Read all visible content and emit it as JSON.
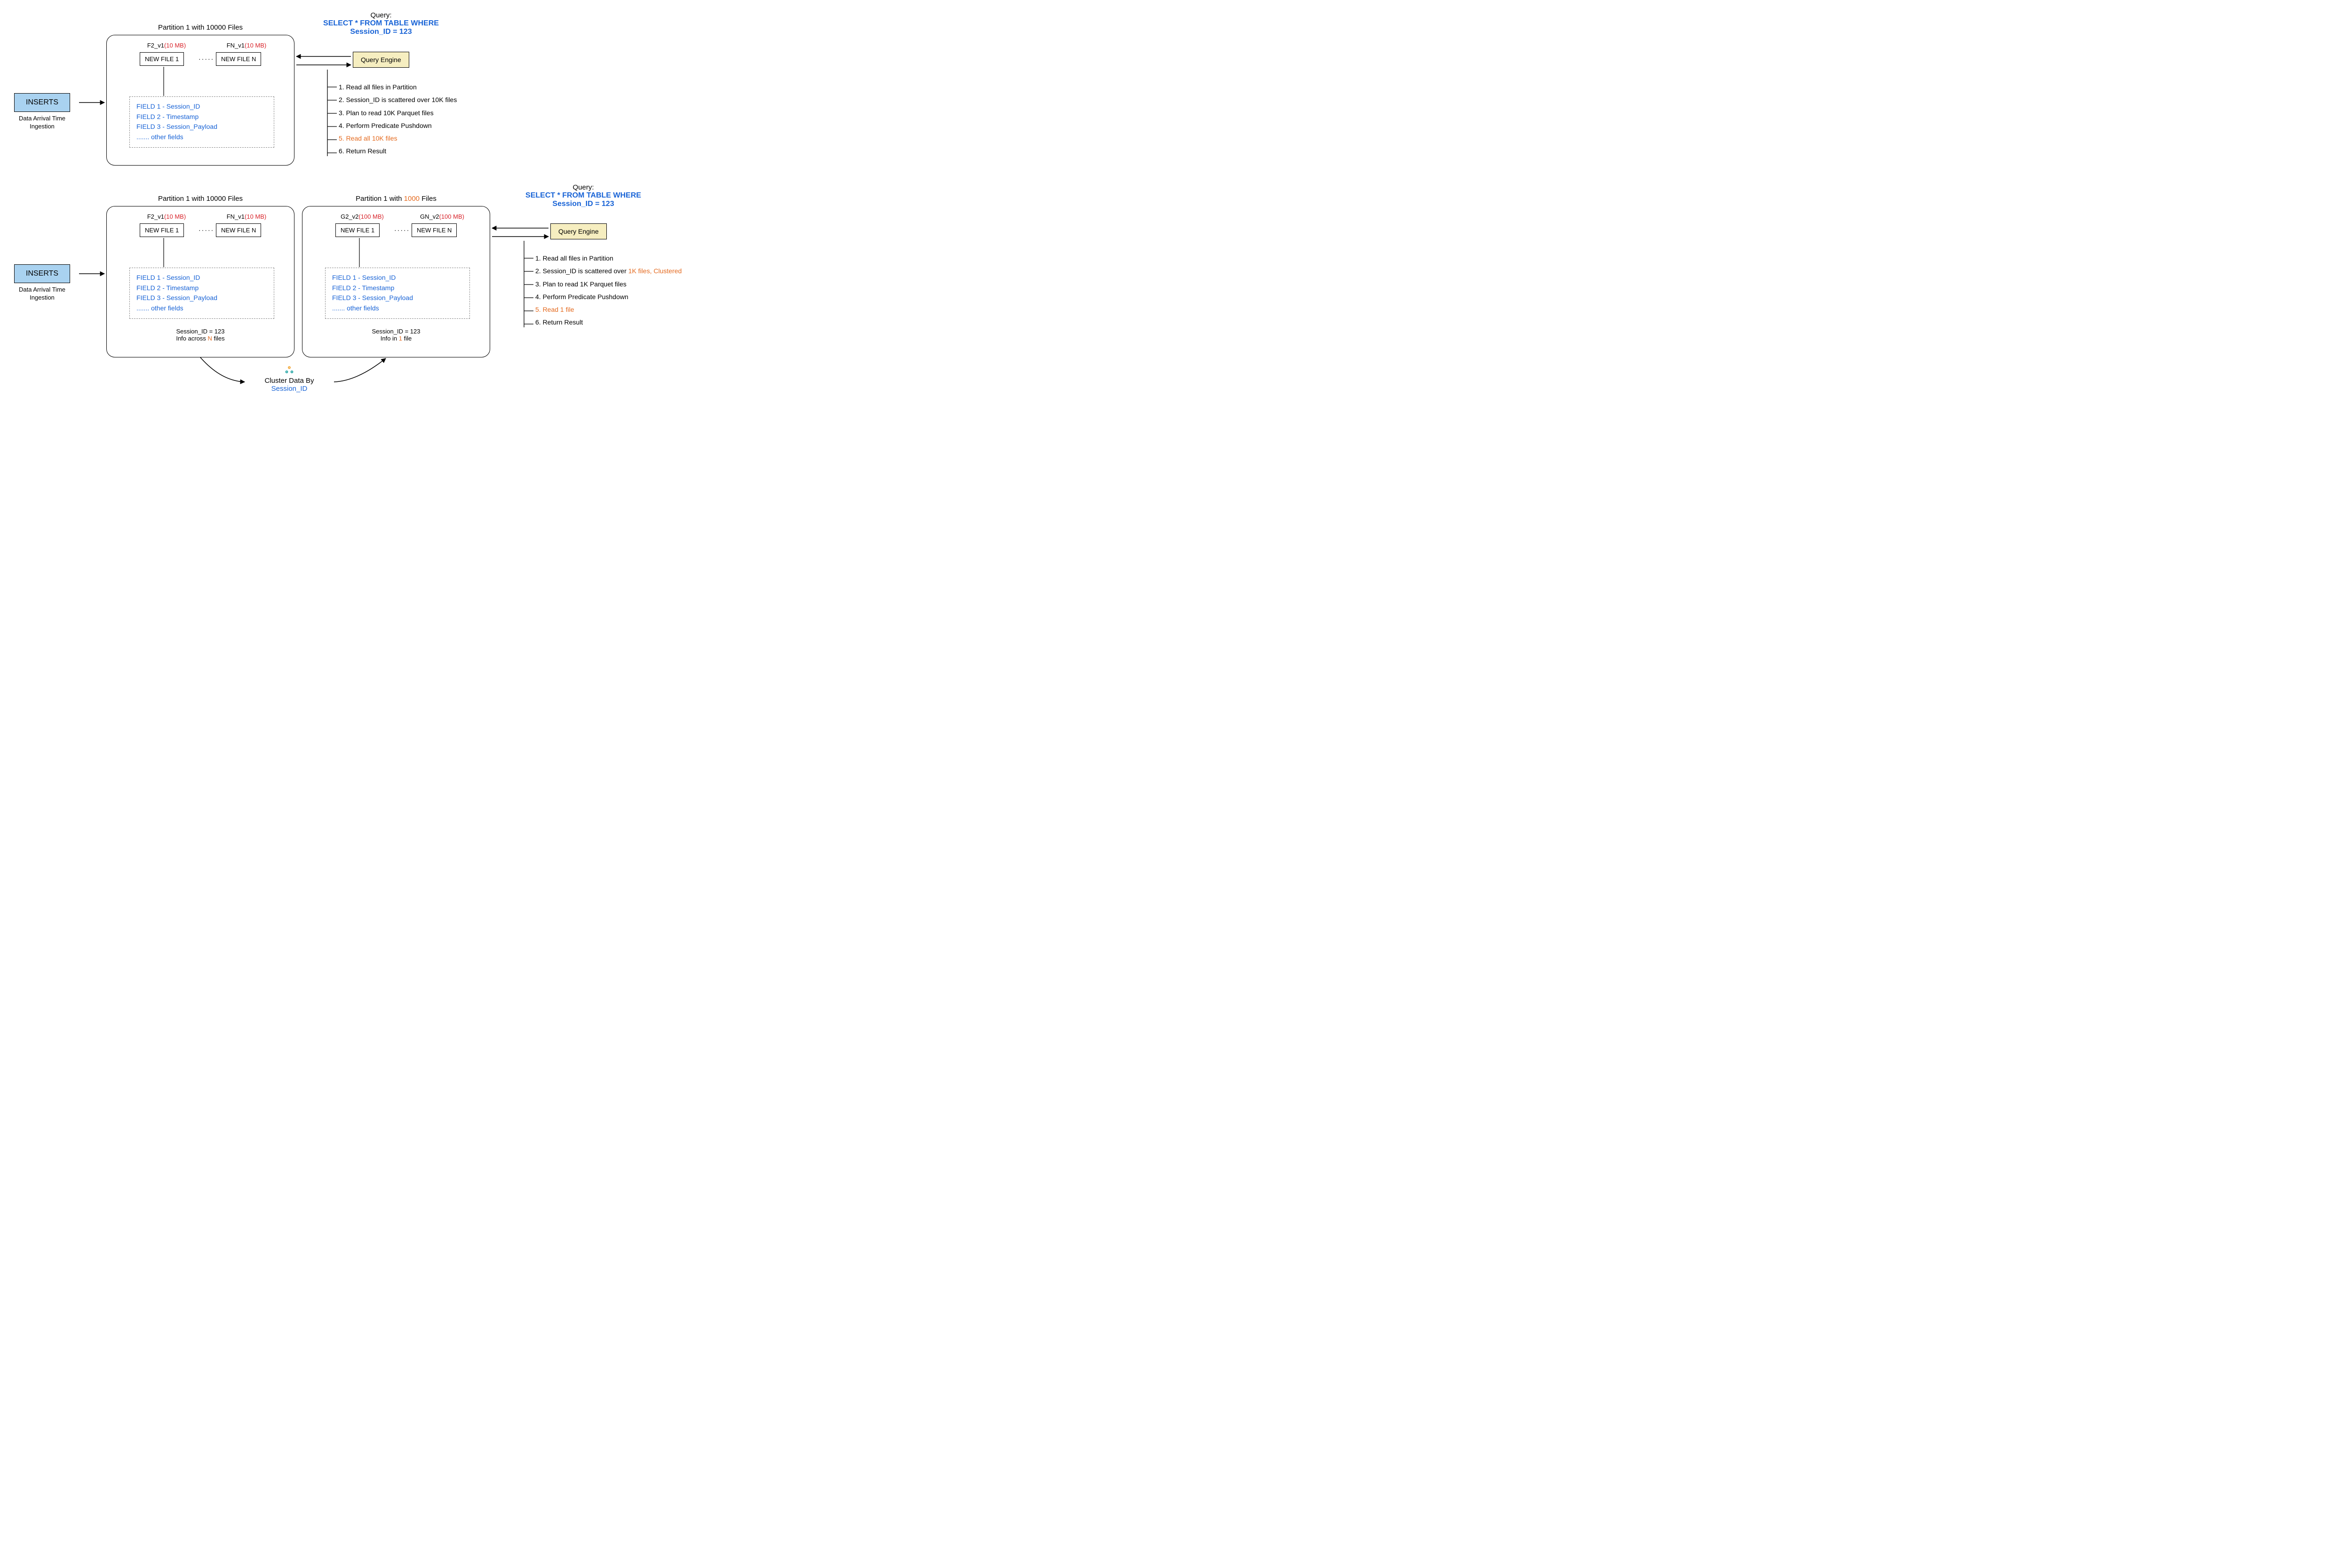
{
  "top": {
    "inserts": {
      "label": "INSERTS",
      "caption_l1": "Data Arrival Time",
      "caption_l2": "Ingestion"
    },
    "partition_title": "Partition 1 with 10000 Files",
    "file1": {
      "hdr_name": "F2_v1",
      "hdr_size": "(10 MB)",
      "label": "NEW FILE 1"
    },
    "file_dots": "·····",
    "fileN": {
      "hdr_name": "FN_v1",
      "hdr_size": "(10 MB)",
      "label": "NEW FILE N"
    },
    "fields": {
      "l1": "FIELD 1 - Session_ID",
      "l2": "FIELD 2 - Timestamp",
      "l3": "FIELD 3 - Session_Payload",
      "l4": "....... other fields"
    },
    "query": {
      "heading": "Query:",
      "line1": "SELECT * FROM TABLE WHERE",
      "line2": "Session_ID = 123",
      "engine": "Query Engine"
    },
    "steps": {
      "s1": "1. Read all files in Partition",
      "s2": "2. Session_ID is scattered over 10K files",
      "s3": "3. Plan to read 10K Parquet files",
      "s4": "4. Perform Predicate Pushdown",
      "s5": "5. Read all 10K files",
      "s6": "6. Return Result"
    }
  },
  "bottom": {
    "inserts": {
      "label": "INSERTS",
      "caption_l1": "Data Arrival Time",
      "caption_l2": "Ingestion"
    },
    "partA": {
      "title": "Partition 1 with 10000 Files",
      "file1": {
        "hdr_name": "F2_v1",
        "hdr_size": "(10 MB)",
        "label": "NEW FILE 1"
      },
      "file_dots": "·····",
      "fileN": {
        "hdr_name": "FN_v1",
        "hdr_size": "(10 MB)",
        "label": "NEW FILE N"
      },
      "fields": {
        "l1": "FIELD 1 - Session_ID",
        "l2": "FIELD 2 - Timestamp",
        "l3": "FIELD 3 - Session_Payload",
        "l4": "....... other fields"
      },
      "foot1": "Session_ID = 123",
      "foot2_pre": "Info across ",
      "foot2_hl": "N",
      "foot2_post": " files"
    },
    "partB": {
      "title_pre": "Partition 1 with ",
      "title_hl": "1000",
      "title_post": " Files",
      "file1": {
        "hdr_name": "G2_v2",
        "hdr_size": "(100 MB)",
        "label": "NEW FILE 1"
      },
      "file_dots": "·····",
      "fileN": {
        "hdr_name": "GN_v2",
        "hdr_size": "(100 MB)",
        "label": "NEW FILE N"
      },
      "fields": {
        "l1": "FIELD 1 - Session_ID",
        "l2": "FIELD 2 - Timestamp",
        "l3": "FIELD 3 - Session_Payload",
        "l4": "....... other fields"
      },
      "foot1": "Session_ID = 123",
      "foot2_pre": "Info in ",
      "foot2_hl": "1",
      "foot2_post": " file"
    },
    "query": {
      "heading": "Query:",
      "line1": "SELECT * FROM TABLE WHERE",
      "line2": "Session_ID = 123",
      "engine": "Query Engine"
    },
    "steps": {
      "s1": "1. Read all files in Partition",
      "s2_pre": "2. Session_ID is scattered over ",
      "s2_hl": "1K files, Clustered",
      "s3": "3. Plan to read 1K Parquet files",
      "s4": "4. Perform Predicate Pushdown",
      "s5": "5. Read 1 file",
      "s6": "6. Return Result"
    },
    "cluster": {
      "line1": "Cluster Data By",
      "line2": "Session_ID"
    }
  }
}
